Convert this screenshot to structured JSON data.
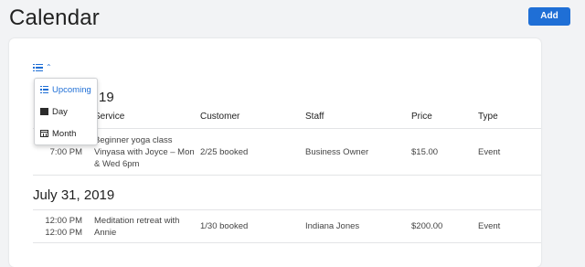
{
  "header": {
    "title": "Calendar",
    "add_label": "Add"
  },
  "view_menu": {
    "items": [
      {
        "label": "Upcoming",
        "icon": "list-icon",
        "active": true
      },
      {
        "label": "Day",
        "icon": "day-icon"
      },
      {
        "label": "Month",
        "icon": "month-icon"
      }
    ]
  },
  "table": {
    "columns": [
      "Service",
      "Customer",
      "Staff",
      "Price",
      "Type"
    ]
  },
  "groups": [
    {
      "date_visible": "19",
      "rows": [
        {
          "start": "",
          "end": "7:00 PM",
          "service_line1": "Beginner yoga class",
          "service_line2": "Vinyasa with Joyce – Mon",
          "service_line3": "& Wed 6pm",
          "customer": "2/25 booked",
          "staff": "Business Owner",
          "price": "$15.00",
          "type": "Event"
        }
      ]
    },
    {
      "date": "July 31, 2019",
      "rows": [
        {
          "start": "12:00 PM",
          "end": "12:00 PM",
          "service_line1": "Meditation retreat with",
          "service_line2": "Annie",
          "customer": "1/30 booked",
          "staff": "Indiana Jones",
          "price": "$200.00",
          "type": "Event"
        }
      ]
    }
  ],
  "colors": {
    "accent": "#1f6fd6",
    "background": "#f2f3f5",
    "card": "#ffffff"
  }
}
